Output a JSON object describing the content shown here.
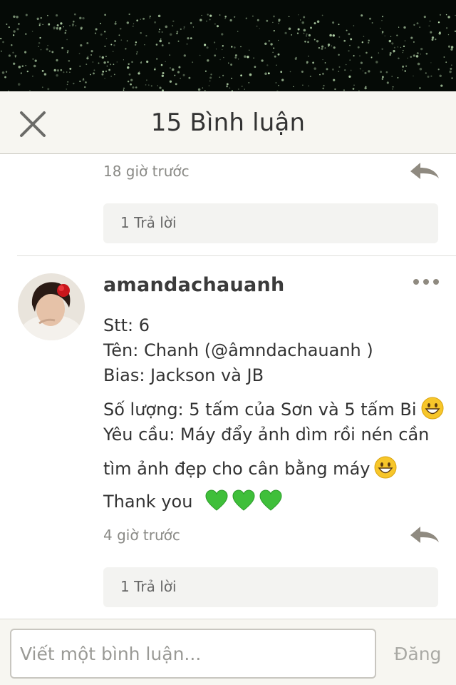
{
  "header": {
    "title": "15 Bình luận"
  },
  "comments": {
    "previous": {
      "timestamp": "18 giờ trước",
      "replies_label": "1 Trả lời"
    },
    "current": {
      "username": "amandachauanh",
      "lines": [
        "Stt: 6",
        "Tên: Chanh (@âmndachauanh )",
        "Bias: Jackson và JB",
        "Số lượng: 5 tấm của Sơn và 5 tấm Bi",
        "Yêu cầu: Máy đẩy ảnh dìm rồi nén cần",
        "tìm ảnh đẹp cho cân bằng máy",
        "Thank you"
      ],
      "timestamp": "4 giờ trước",
      "replies_label": "1 Trả lời"
    }
  },
  "composer": {
    "placeholder": "Viết một bình luận...",
    "post_label": "Đăng"
  },
  "icons": {
    "close": "close-icon",
    "reply": "reply-arrow-icon",
    "more": "more-dots-icon",
    "smile": "grinning-emoji-icon",
    "heart": "green-heart-emoji-icon"
  },
  "colors": {
    "header_bg": "#f7f6f1",
    "reply_box_bg": "#f3f3f1",
    "heart_green": "#3fbf3a"
  }
}
